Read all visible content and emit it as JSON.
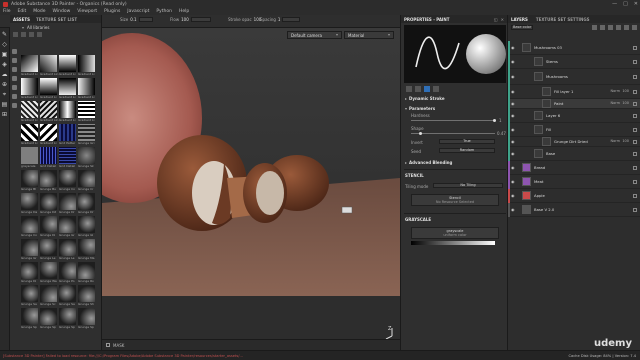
{
  "window": {
    "title": "Adobe Substance 3D Painter - Organics (Read only)",
    "controls": [
      "—",
      "□",
      "✕"
    ]
  },
  "menu": [
    "File",
    "Edit",
    "Mode",
    "Window",
    "Viewport",
    "Plugins",
    "Javascript",
    "Python",
    "Help"
  ],
  "toolbar": {
    "size_label": "Size",
    "size_value": "0.1",
    "flow_label": "Flow",
    "flow_value": "100",
    "stroke_label": "Stroke opac",
    "stroke_value": "100",
    "spacing_label": "Spacing",
    "spacing_value": "1"
  },
  "viewport": {
    "camera": "Default camera",
    "material": "Material",
    "axis_label": "Z",
    "bottom_label": "MASK"
  },
  "assets": {
    "tabs": [
      "ASSETS",
      "TEXTURE SET LIST"
    ],
    "library_label": "All libraries",
    "thumbs": [
      {
        "label": "Gradient Li"
      },
      {
        "label": "Gradient Lin"
      },
      {
        "label": "Gradient Li"
      },
      {
        "label": "Gradient Li"
      },
      {
        "label": "Gradient Li"
      },
      {
        "label": "Gradient Li"
      },
      {
        "label": "Gradient Li"
      },
      {
        "label": "Gradient Li"
      },
      {
        "label": "Gradient Li"
      },
      {
        "label": "Gradient Lin"
      },
      {
        "label": "Gradient Li"
      },
      {
        "label": "Gradient Li"
      },
      {
        "label": "Gradient Li"
      },
      {
        "label": "Gradient Li"
      },
      {
        "label": "Grid Patter"
      },
      {
        "label": "Grunge Gri"
      },
      {
        "label": "grayscale"
      },
      {
        "label": "Grid Detail"
      },
      {
        "label": "Grid Detail"
      },
      {
        "label": "Grunge Sk"
      },
      {
        "label": "Grunge Bl"
      },
      {
        "label": "Grunge Bu"
      },
      {
        "label": "Grunge Co"
      },
      {
        "label": "Grunge Cr"
      },
      {
        "label": "Grunge Da"
      },
      {
        "label": "Grunge Dd"
      },
      {
        "label": "Grunge Dr"
      },
      {
        "label": "Grunge Dr"
      },
      {
        "label": "Grunge Co"
      },
      {
        "label": "Grunge Di"
      },
      {
        "label": "Grunge Gr"
      },
      {
        "label": "Grunge Gl"
      },
      {
        "label": "Grunge Gr"
      },
      {
        "label": "Grunge Le"
      },
      {
        "label": "Grunge Le"
      },
      {
        "label": "Grunge Ma"
      },
      {
        "label": "Grunge Di"
      },
      {
        "label": "Grunge Wa"
      },
      {
        "label": "Grunge Po"
      },
      {
        "label": "Grunge Ro"
      },
      {
        "label": "Grunge Sa"
      },
      {
        "label": "Grunge Sc"
      },
      {
        "label": "Grunge Sa"
      },
      {
        "label": "Grunge Sh"
      },
      {
        "label": "Grunge Sp"
      },
      {
        "label": "Grunge Sp"
      },
      {
        "label": "Grunge Sp"
      },
      {
        "label": "Grunge Sp"
      }
    ]
  },
  "properties": {
    "header": "PROPERTIES - PAINT",
    "dynamic_stroke": "Dynamic Stroke",
    "parameters": "Parameters",
    "hardness_label": "Hardness",
    "hardness_value": "1",
    "shape_label": "Shape",
    "shape_value": "0.47",
    "invert_label": "Invert",
    "invert_value": "True",
    "seed_label": "Seed",
    "seed_value": "Random",
    "advanced": "Advanced Blending",
    "stencil_header": "STENCIL",
    "tiling_label": "Tiling mode",
    "tiling_value": "No Tiling",
    "stencil_btn": "Stencil",
    "stencil_sub": "No Resource Selected",
    "grayscale_header": "GRAYSCALE",
    "grayscale_btn": "grayscale",
    "grayscale_sub": "uniform color"
  },
  "layers": {
    "tabs": [
      "LAYERS",
      "TEXTURE SET SETTINGS"
    ],
    "channel": "Base color",
    "rows": [
      {
        "name": "Mushrooms 03",
        "blend": "",
        "opacity": "",
        "color": "#3fa38a"
      },
      {
        "name": "Stems",
        "blend": "",
        "opacity": "",
        "color": "#3fa38a"
      },
      {
        "name": "Mushrooms",
        "blend": "",
        "opacity": "",
        "color": "#3fa38a"
      },
      {
        "name": "Fill layer 1",
        "blend": "Norm",
        "opacity": "100",
        "color": "#3fa38a"
      },
      {
        "name": "Paint",
        "blend": "Norm",
        "opacity": "100",
        "color": "#3fa38a"
      },
      {
        "name": "Layer 6",
        "blend": "",
        "opacity": "",
        "color": "#3fa38a"
      },
      {
        "name": "Fill",
        "blend": "",
        "opacity": "",
        "color": "#3fa38a"
      },
      {
        "name": "Grunge Dirt Dried",
        "blend": "Norm",
        "opacity": "100",
        "color": "#3fa38a"
      },
      {
        "name": "Base",
        "blend": "",
        "opacity": "",
        "color": "#3fa38a"
      },
      {
        "name": "Bread",
        "blend": "",
        "opacity": "",
        "color": "#8e55b0"
      },
      {
        "name": "Meat",
        "blend": "",
        "opacity": "",
        "color": "#8e55b0"
      },
      {
        "name": "Apple",
        "blend": "",
        "opacity": "",
        "color": "#c94a4a"
      },
      {
        "name": "Base V 2.0",
        "blend": "",
        "opacity": "",
        "color": "#555555"
      }
    ]
  },
  "statusbar": {
    "message": "[Substance 3D Painter] Failed to load resource: file:///C:/Program Files/Adobe/Adobe Substance 3D Painter/resources/starter_assets/...",
    "right": "Cache Disk Usage: 84% | Version: 7.4"
  },
  "watermark": "udemy"
}
